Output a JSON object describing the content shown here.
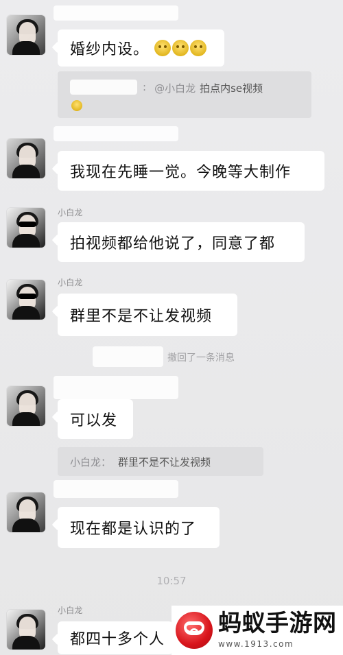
{
  "chat": {
    "messages": [
      {
        "type": "text",
        "text": "婚纱内设。"
      },
      {
        "type": "quote",
        "prefix": "@小白龙",
        "text": "拍点内se视频"
      },
      {
        "type": "text",
        "text": "我现在先睡一觉。今晚等大制作"
      },
      {
        "sender": "小白龙",
        "type": "text",
        "text": "拍视频都给他说了，同意了都"
      },
      {
        "sender": "小白龙",
        "type": "text",
        "text": "群里不是不让发视频"
      },
      {
        "type": "system",
        "text": "撤回了一条消息"
      },
      {
        "type": "text",
        "text": "可以发"
      },
      {
        "type": "quote",
        "prefix": "小白龙：",
        "text": "群里不是不让发视频"
      },
      {
        "type": "text",
        "text": "现在都是认识的了"
      },
      {
        "type": "time",
        "text": "10:57"
      },
      {
        "sender": "小白龙",
        "type": "text",
        "text": "都四十多个人"
      }
    ]
  },
  "watermark": {
    "title": "蚂蚁手游网",
    "url": "www.1913.com",
    "icon": "ant-logo-icon"
  }
}
